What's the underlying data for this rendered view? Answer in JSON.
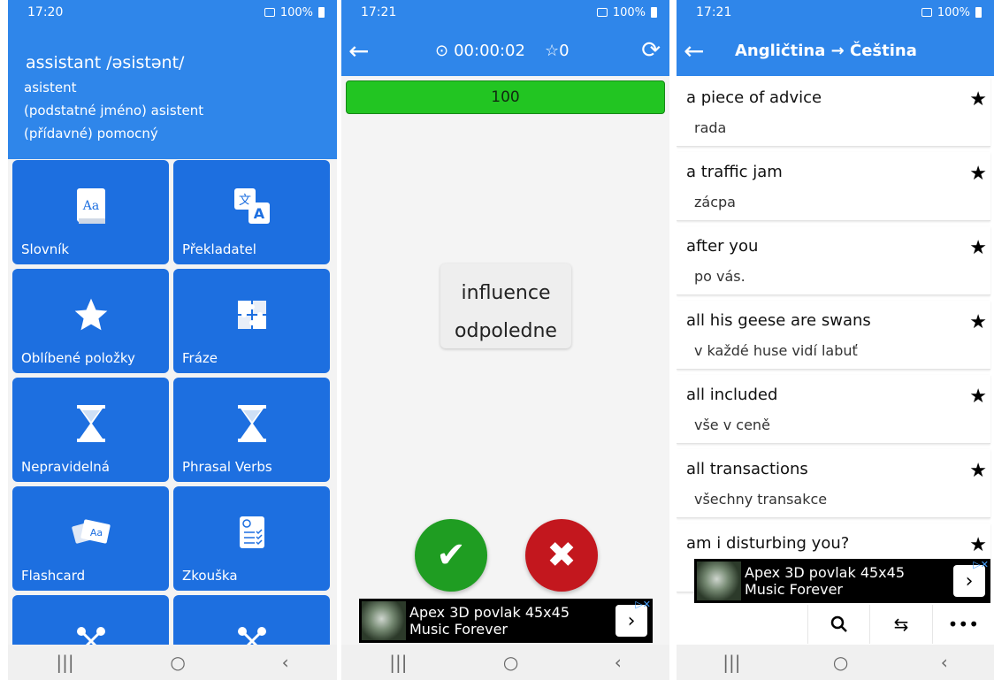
{
  "colors": {
    "primary_blue": "#2f86ea",
    "tile_blue": "#1d6fe0",
    "correct_green": "#1f9d22",
    "wrong_red": "#c3171e",
    "progress_green": "#22c522"
  },
  "status": {
    "s1_time": "17:20",
    "s2_time": "17:21",
    "s3_time": "17:21",
    "battery": "100%"
  },
  "home": {
    "word": "assistant  /əsistənt/",
    "lines": [
      "asistent",
      "(podstatné jméno) asistent",
      "(přídavné) pomocný"
    ],
    "tiles": [
      {
        "label": "Slovník",
        "icon": "dictionary-icon"
      },
      {
        "label": "Překladatel",
        "icon": "translate-icon"
      },
      {
        "label": "Oblíbené položky",
        "icon": "star-icon"
      },
      {
        "label": "Fráze",
        "icon": "puzzle-icon"
      },
      {
        "label": "Nepravidelná",
        "icon": "hourglass-icon"
      },
      {
        "label": "Phrasal Verbs",
        "icon": "hourglass-icon"
      },
      {
        "label": "Flashcard",
        "icon": "flashcard-icon"
      },
      {
        "label": "Zkouška",
        "icon": "exam-icon"
      },
      {
        "label": "",
        "icon": "game-icon"
      },
      {
        "label": "",
        "icon": "game-icon"
      }
    ]
  },
  "quiz": {
    "timer": "00:00:02",
    "stars": "0",
    "progress": "100",
    "word": "influence",
    "translation": "odpoledne"
  },
  "favorites": {
    "title": "Angličtina → Čeština",
    "items": [
      {
        "en": "a piece of advice",
        "cs": "rada"
      },
      {
        "en": "a traffic jam",
        "cs": "zácpa"
      },
      {
        "en": "after you",
        "cs": "po vás."
      },
      {
        "en": "all his geese are swans",
        "cs": "v každé huse vidí labuť"
      },
      {
        "en": "all included",
        "cs": "vše v ceně"
      },
      {
        "en": "all transactions",
        "cs": "všechny transakce"
      },
      {
        "en": "am i disturbing you?",
        "cs": ""
      }
    ]
  },
  "ad": {
    "line1": "Apex 3D povlak 45x45",
    "line2": "Music Forever"
  }
}
